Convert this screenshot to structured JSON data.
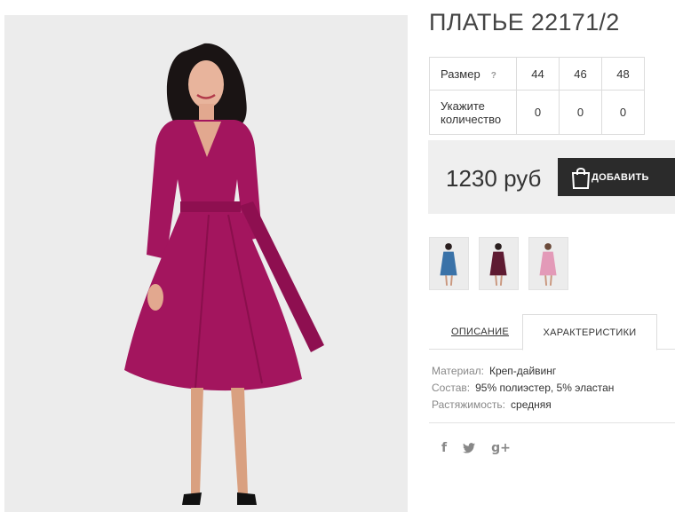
{
  "product": {
    "title": "ПЛАТЬЕ 22171/2",
    "image_alt": "Model wearing a magenta wrap dress"
  },
  "sizes": {
    "size_label": "Размер",
    "help_icon": "?",
    "sizes": [
      "44",
      "46",
      "48"
    ],
    "qty_label": "Укажите количество",
    "quantities": [
      "0",
      "0",
      "0"
    ]
  },
  "purchase": {
    "price": "1230 руб",
    "add_label": "ДОБАВИТЬ",
    "icon": "shopping-bag-icon"
  },
  "thumbnails": [
    {
      "color": "#3a72a8",
      "name": "blue"
    },
    {
      "color": "#5e1b32",
      "name": "burgundy"
    },
    {
      "color": "#e39ab8",
      "name": "pink"
    }
  ],
  "tabs": {
    "description": "ОПИСАНИЕ",
    "characteristics": "ХАРАКТЕРИСТИКИ",
    "active": "characteristics"
  },
  "specs": [
    {
      "key": "Материал:",
      "value": "Креп-дайвинг"
    },
    {
      "key": "Состав:",
      "value": "95% полиэстер, 5% эластан"
    },
    {
      "key": "Растяжимость:",
      "value": "средняя"
    }
  ],
  "social": {
    "facebook": "f",
    "twitter": "🐦",
    "google": "g+"
  },
  "colors": {
    "dress": "#a3155e",
    "button_bg": "#2b2b2b",
    "price_box_bg": "#efefef"
  }
}
